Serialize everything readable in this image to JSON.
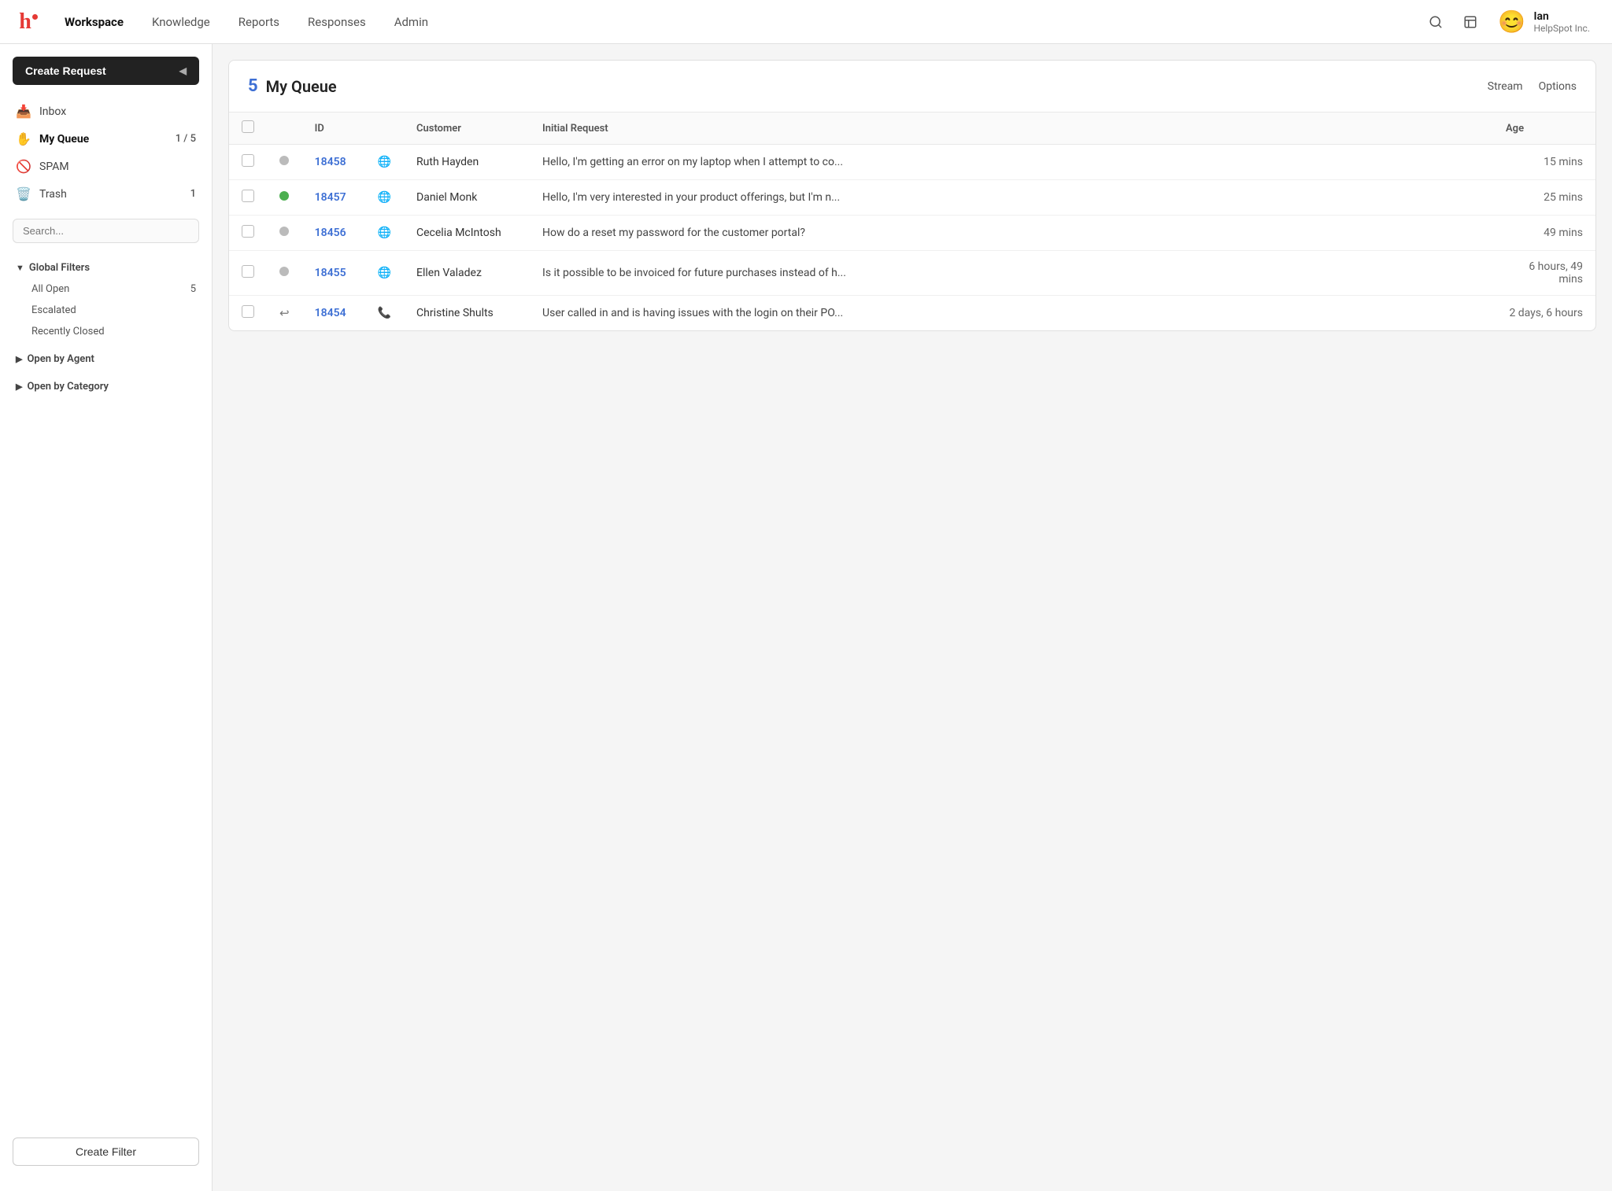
{
  "app": {
    "logo_text": "h",
    "logo_dot": "·"
  },
  "topnav": {
    "items": [
      {
        "label": "Workspace",
        "active": true
      },
      {
        "label": "Knowledge",
        "active": false
      },
      {
        "label": "Reports",
        "active": false
      },
      {
        "label": "Responses",
        "active": false
      },
      {
        "label": "Admin",
        "active": false
      }
    ],
    "search_title": "Search",
    "notes_title": "Notes"
  },
  "user": {
    "avatar": "😊",
    "name": "Ian",
    "company": "HelpSpot Inc."
  },
  "sidebar": {
    "create_request_label": "Create Request",
    "nav_items": [
      {
        "icon": "📥",
        "label": "Inbox",
        "badge": ""
      },
      {
        "icon": "✋",
        "label": "My Queue",
        "badge": "1 / 5",
        "active": true
      },
      {
        "icon": "🚫",
        "label": "SPAM",
        "badge": ""
      },
      {
        "icon": "🗑️",
        "label": "Trash",
        "badge": "1"
      }
    ],
    "search_placeholder": "Search...",
    "global_filters_label": "Global Filters",
    "filter_items": [
      {
        "label": "All Open",
        "badge": "5"
      },
      {
        "label": "Escalated",
        "badge": ""
      },
      {
        "label": "Recently Closed",
        "badge": ""
      }
    ],
    "open_by_agent_label": "Open by Agent",
    "open_by_category_label": "Open by Category",
    "create_filter_label": "Create Filter"
  },
  "queue": {
    "count": "5",
    "title": "My Queue",
    "actions": [
      {
        "label": "Stream"
      },
      {
        "label": "Options"
      }
    ],
    "columns": {
      "id": "ID",
      "customer": "Customer",
      "initial_request": "Initial Request",
      "age": "Age"
    },
    "rows": [
      {
        "id": "18458",
        "status": "gray",
        "channel": "web",
        "customer": "Ruth Hayden",
        "request": "Hello, I'm getting an error on my laptop when I attempt to co...",
        "age": "15 mins",
        "icon_type": "globe"
      },
      {
        "id": "18457",
        "status": "green",
        "channel": "web",
        "customer": "Daniel Monk",
        "request": "Hello, I'm very interested in your product offerings, but I'm n...",
        "age": "25 mins",
        "icon_type": "globe"
      },
      {
        "id": "18456",
        "status": "gray",
        "channel": "web",
        "customer": "Cecelia McIntosh",
        "request": "How do a reset my password for the customer portal?",
        "age": "49 mins",
        "icon_type": "globe"
      },
      {
        "id": "18455",
        "status": "gray",
        "channel": "web",
        "customer": "Ellen Valadez",
        "request": "Is it possible to be invoiced for future purchases instead of h...",
        "age": "6 hours, 49 mins",
        "icon_type": "globe"
      },
      {
        "id": "18454",
        "status": "reply",
        "channel": "phone",
        "customer": "Christine Shults",
        "request": "User called in and is having issues with the login on their PO...",
        "age": "2 days, 6 hours",
        "icon_type": "phone"
      }
    ]
  }
}
